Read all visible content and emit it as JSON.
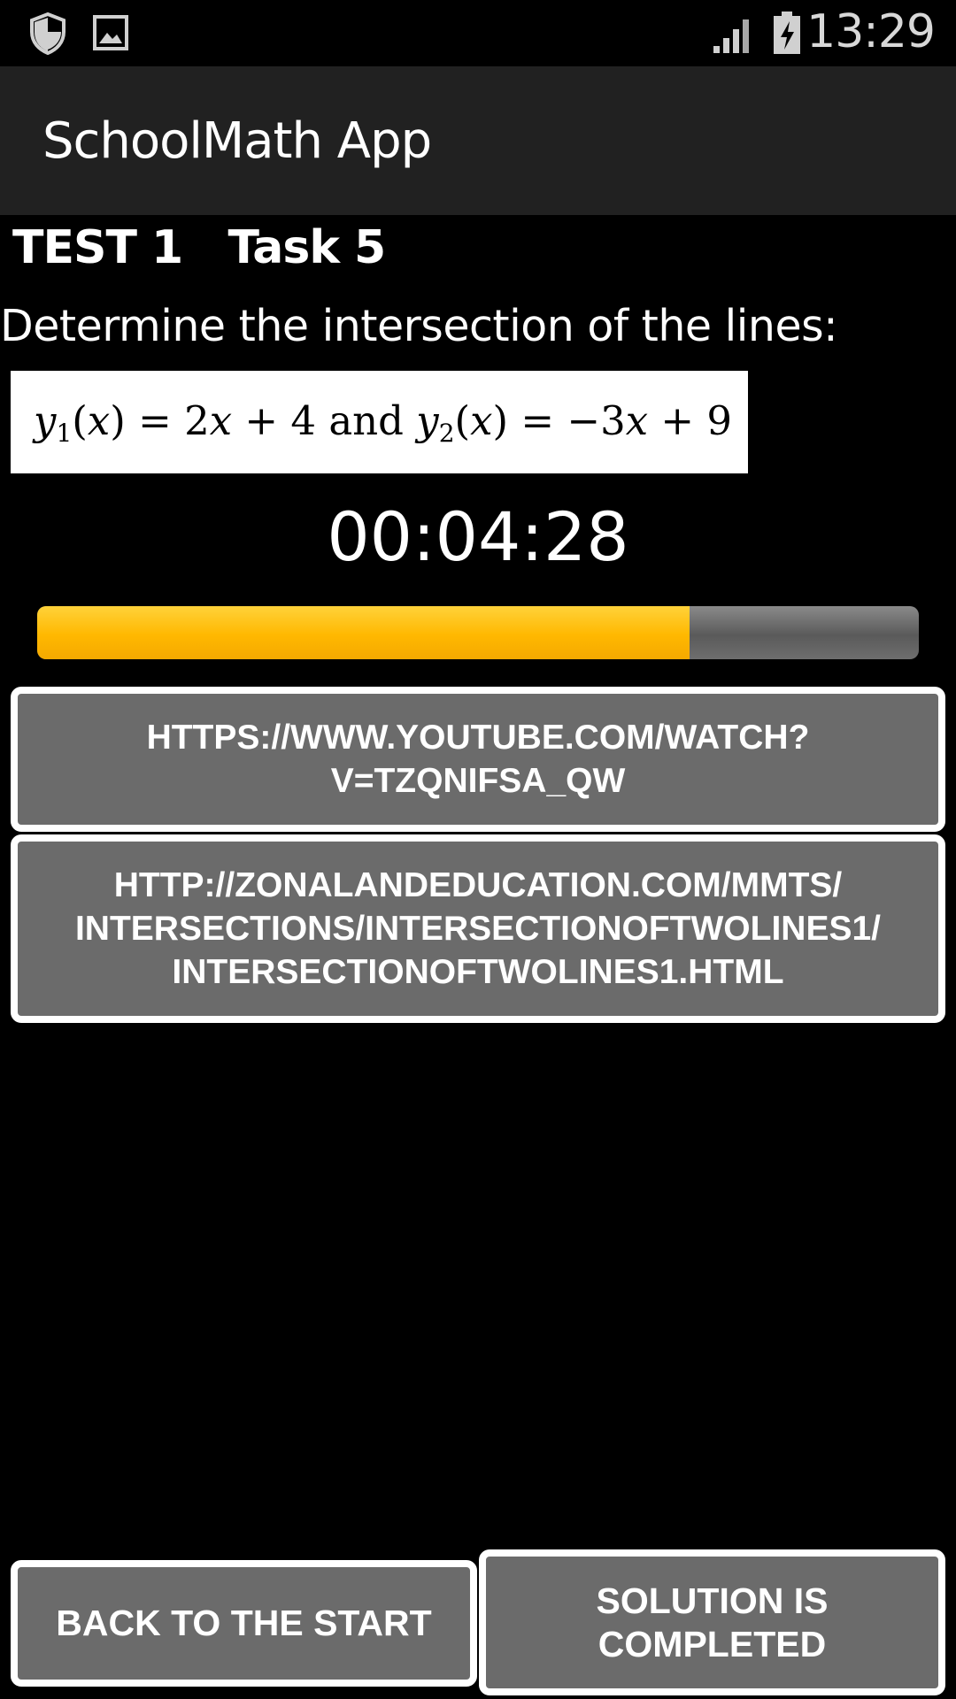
{
  "status_bar": {
    "time": "13:29",
    "icons": [
      "shield-icon",
      "image-icon",
      "signal-icon",
      "battery-charging-icon"
    ]
  },
  "action_bar": {
    "title": "SchoolMath App"
  },
  "task": {
    "header": "TEST 1   Task 5",
    "question": "Determine the intersection of the lines:",
    "formula": "y1(x) = 2x + 4 and y2(x) = −3x + 9",
    "timer": "00:04:28",
    "progress_percent": 74
  },
  "links": [
    {
      "label": "HTTPS://WWW.YOUTUBE.COM/WATCH?V=TZQNIFSA_QW",
      "lines": [
        "HTTPS://WWW.YOUTUBE.COM/WATCH?",
        "V=TZQNIFSA_QW"
      ]
    },
    {
      "label": "HTTP://ZONALANDEDUCATION.COM/MMTS/INTERSECTIONS/INTERSECTIONOFTWOLINES1/INTERSECTIONOFTWOLINES1.HTML",
      "lines": [
        "HTTP://ZONALANDEDUCATION.COM/MMTS/",
        "INTERSECTIONS/INTERSECTIONOFTWOLINES1/",
        "INTERSECTIONOFTWOLINES1.HTML"
      ]
    }
  ],
  "buttons": {
    "back": "BACK TO THE START",
    "solution_lines": [
      "SOLUTION IS",
      "COMPLETED"
    ]
  },
  "colors": {
    "progress_fill": "#ffb800",
    "progress_track": "#6e6e6e",
    "button_bg": "#6b6b6b",
    "action_bar_bg": "#212121"
  }
}
